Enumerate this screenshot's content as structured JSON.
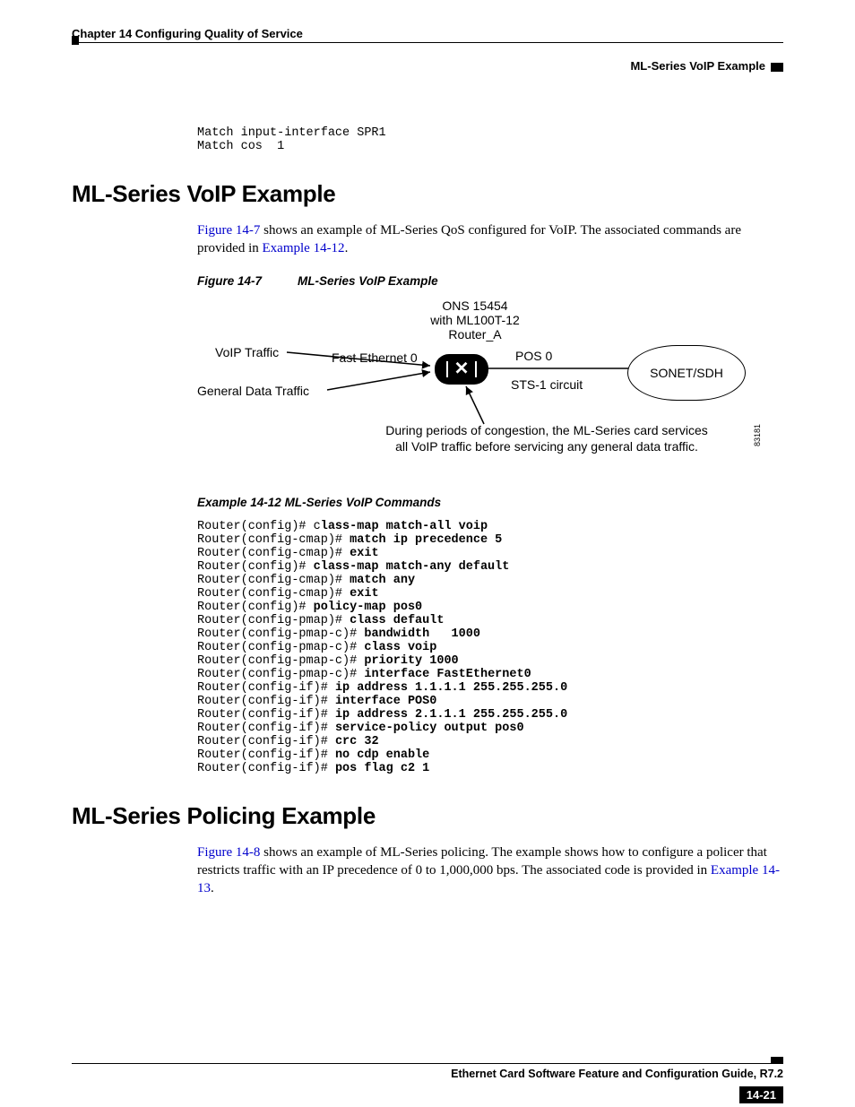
{
  "header": {
    "chapter_line": "Chapter 14 Configuring Quality of Service",
    "section_right": "ML-Series VoIP Example"
  },
  "pre_code": "Match input-interface SPR1\nMatch cos  1",
  "voip": {
    "heading": "ML-Series VoIP Example",
    "para_pre": "",
    "link_fig": "Figure 14-7",
    "para_mid": " shows an example of ML-Series QoS configured for VoIP. The associated commands are provided in ",
    "link_ex": "Example 14-12",
    "para_end": ".",
    "fig_label": "Figure 14-7",
    "fig_title": "ML-Series VoIP Example",
    "diagram": {
      "ons_line1": "ONS 15454",
      "ons_line2": "with ML100T-12",
      "ons_line3": "Router_A",
      "voip_traffic": "VoIP Traffic",
      "general_traffic": "General Data Traffic",
      "fe0": "Fast Ethernet 0",
      "pos0": "POS 0",
      "sts1": "STS-1 circuit",
      "sonet": "SONET/SDH",
      "note_l1": "During periods of congestion, the ML-Series card services",
      "note_l2": "all VoIP traffic before servicing any general data traffic.",
      "fig_id": "83181"
    },
    "ex_label": "Example 14-12",
    "ex_title": "ML-Series VoIP Commands",
    "cmds": [
      {
        "p": "Router(config)# c",
        "b": "lass-map match-all voip"
      },
      {
        "p": "Router(config-cmap)# ",
        "b": "match ip precedence 5"
      },
      {
        "p": "Router(config-cmap)# ",
        "b": "exit"
      },
      {
        "p": "Router(config)# ",
        "b": "class-map match-any default"
      },
      {
        "p": "Router(config-cmap)# ",
        "b": "match any"
      },
      {
        "p": "Router(config-cmap)# ",
        "b": "exit"
      },
      {
        "p": "Router(config)# ",
        "b": "policy-map pos0"
      },
      {
        "p": "Router(config-pmap)# ",
        "b": "class default"
      },
      {
        "p": "Router(config-pmap-c)# ",
        "b": "bandwidth   1000"
      },
      {
        "p": "Router(config-pmap-c)# ",
        "b": "class voip"
      },
      {
        "p": "Router(config-pmap-c)# ",
        "b": "priority 1000"
      },
      {
        "p": "Router(config-pmap-c)# ",
        "b": "interface FastEthernet0"
      },
      {
        "p": "Router(config-if)# ",
        "b": "ip address 1.1.1.1 255.255.255.0"
      },
      {
        "p": "Router(config-if)# ",
        "b": "interface POS0"
      },
      {
        "p": "Router(config-if)# ",
        "b": "ip address 2.1.1.1 255.255.255.0"
      },
      {
        "p": "Router(config-if)# ",
        "b": "service-policy output pos0"
      },
      {
        "p": "Router(config-if)# ",
        "b": "crc 32"
      },
      {
        "p": "Router(config-if)# ",
        "b": "no cdp enable"
      },
      {
        "p": "Router(config-if)# ",
        "b": "pos flag c2 1"
      }
    ]
  },
  "policing": {
    "heading": "ML-Series Policing Example",
    "link_fig": "Figure 14-8",
    "para_mid": " shows an example of ML-Series policing. The example shows how to configure a policer that restricts traffic with an IP precedence of 0 to 1,000,000 bps. The associated code is provided in ",
    "link_ex": "Example 14-13",
    "para_end": "."
  },
  "footer": {
    "guide": "Ethernet Card Software Feature and Configuration Guide, R7.2",
    "pagenum": "14-21"
  }
}
